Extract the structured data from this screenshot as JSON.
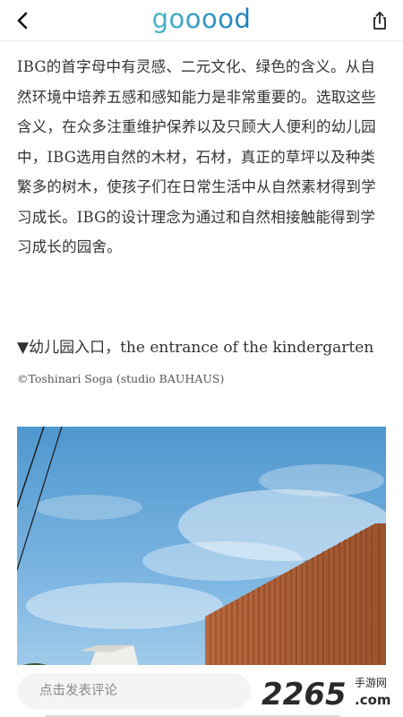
{
  "header": {
    "logo_text": "gooood",
    "back_icon": "chevron-left-icon",
    "share_icon": "share-icon"
  },
  "article": {
    "paragraph": "IBG的首字母中有灵感、二元文化、绿色的含义。从自然环境中培养五感和感知能力是非常重要的。选取这些含义，在众多注重维护保养以及只顾大人便利的幼儿园中，IBG选用自然的木材，石材，真正的草坪以及种类繁多的树木，使孩子们在日常生活中从自然素材得到学习成长。IBG的设计理念为通过和自然相接触能得到学习成长的园舍。",
    "caption_marker": "▼",
    "caption": "幼儿园入口，the entrance of the kindergarten",
    "credit": "©Toshinari Soga (studio BAUHAUS)"
  },
  "comment": {
    "placeholder": "点击发表评论"
  },
  "watermark": {
    "brand_number": "2265",
    "brand_suffix": ".com",
    "brand_label": "手游网"
  },
  "colors": {
    "logo_gradient_start": "#49b6c9",
    "logo_gradient_end": "#1f7fc0",
    "text": "#333333",
    "placeholder": "#8a8a8a"
  }
}
